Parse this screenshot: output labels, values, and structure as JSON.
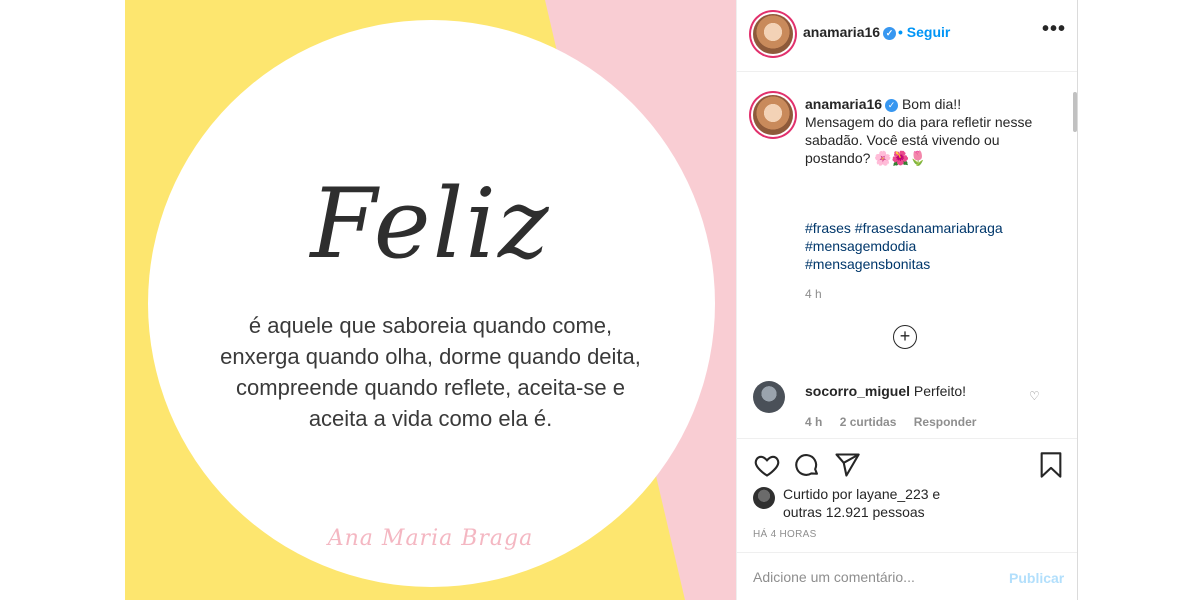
{
  "post_image": {
    "headline": "Feliz",
    "quote_lines": [
      "é aquele que saboreia quando come,",
      "enxerga quando olha, dorme quando deita,",
      "compreende quando reflete, aceita-se e",
      "aceita a vida como ela é."
    ],
    "signature": "Ana Maria Braga",
    "colors": {
      "pink": "#f9cdd3",
      "yellow": "#fde66f",
      "circle": "#ffffff"
    }
  },
  "header": {
    "username": "anamaria16",
    "verified_icon": "verified-badge-icon",
    "follow_label": "• Seguir",
    "more_icon": "more-options-icon",
    "more_glyph": "•••"
  },
  "caption": {
    "username": "anamaria16",
    "lines": [
      "Bom dia!!",
      "Mensagem do dia para refletir nesse",
      "sabadão. Você está vivendo ou",
      "postando? 🌸🌺🌷"
    ],
    "hashtags": [
      "#frases #frasesdanamariabraga",
      "#mensagemdodia",
      "#mensagensbonitas"
    ],
    "time": "4 h"
  },
  "load_more_glyph": "+",
  "comment": {
    "username": "socorro_miguel",
    "text": "Perfeito!",
    "time": "4 h",
    "likes": "2 curtidas",
    "reply_label": "Responder",
    "like_glyph": "♡"
  },
  "actions": {
    "like_icon": "heart-icon",
    "comment_icon": "comment-bubble-icon",
    "share_icon": "paper-plane-icon",
    "save_icon": "bookmark-icon"
  },
  "likes_summary": {
    "line1": "Curtido por layane_223 e",
    "line2": "outras 12.921 pessoas"
  },
  "post_time": "HÁ 4 HORAS",
  "add_comment": {
    "placeholder": "Adicione um comentário...",
    "publish_label": "Publicar"
  },
  "brand_colors": {
    "link": "#0095f6",
    "hashtag": "#00376b",
    "muted": "#8e8e8e"
  }
}
